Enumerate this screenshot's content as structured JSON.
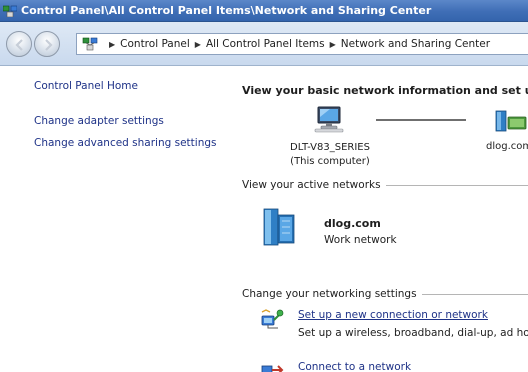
{
  "window": {
    "title": "Control Panel\\All Control Panel Items\\Network and Sharing Center"
  },
  "address": {
    "crumbs": [
      "Control Panel",
      "All Control Panel Items",
      "Network and Sharing Center"
    ]
  },
  "sidebar": {
    "home": "Control Panel Home",
    "links": [
      "Change adapter settings",
      "Change advanced sharing settings"
    ]
  },
  "main": {
    "heading": "View your basic network information and set up",
    "computer_name": "DLT-V83_SERIES",
    "computer_sub": "(This computer)",
    "network_map_domain": "dlog.com",
    "active_networks_label": "View your active networks",
    "active_network": {
      "name": "dlog.com",
      "type": "Work network"
    },
    "change_settings_label": "Change your networking settings",
    "tasks": [
      {
        "label": "Set up a new connection or network",
        "description": "Set up a wireless, broadband, dial-up, ad hoc"
      },
      {
        "label": "Connect to a network"
      }
    ]
  },
  "icons": {
    "titlebar": "network-sharing-icon",
    "back": "back-arrow-icon",
    "forward": "forward-arrow-icon",
    "breadcrumb": "network-sharing-icon",
    "computer": "computer-icon",
    "domain": "domain-network-icon",
    "active_network": "domain-network-icon",
    "setup": "setup-connection-icon",
    "connect": "connect-network-icon"
  },
  "colors": {
    "titlebar": "#3f6eb6",
    "link": "#1e3287",
    "address_bar": "#c9d9ee"
  }
}
